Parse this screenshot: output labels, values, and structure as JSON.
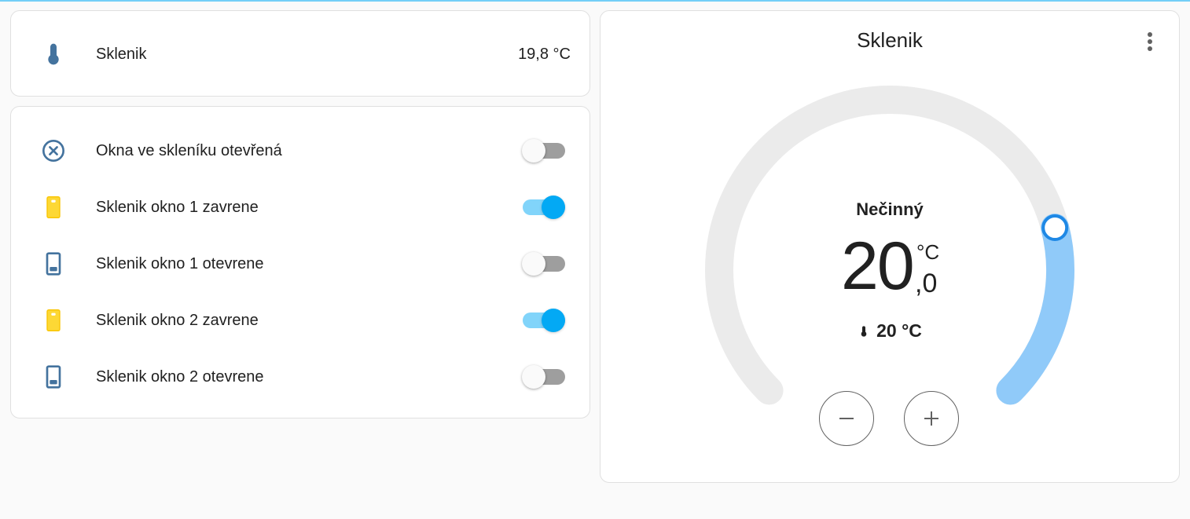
{
  "sensor": {
    "name": "Sklenik",
    "value": "19,8 °C"
  },
  "entities": [
    {
      "label": "Okna ve skleníku otevřená",
      "icon": "close-circle-outline-icon",
      "state": "off"
    },
    {
      "label": "Sklenik okno 1 zavrene",
      "icon": "window-closed-icon",
      "state": "on"
    },
    {
      "label": "Sklenik okno 1 otevrene",
      "icon": "window-open-icon",
      "state": "off"
    },
    {
      "label": "Sklenik okno 2 zavrene",
      "icon": "window-closed-icon",
      "state": "on"
    },
    {
      "label": "Sklenik okno 2 otevrene",
      "icon": "window-open-icon",
      "state": "off"
    }
  ],
  "thermostat": {
    "title": "Sklenik",
    "state": "Nečinný",
    "target_integer": "20",
    "target_decimal": ",0",
    "unit": "°C",
    "current": "20 °C",
    "minus": "−",
    "plus": "+",
    "setpoint_fraction": 0.78
  },
  "colors": {
    "accent": "#03a9f4",
    "accent_light": "#90caf9",
    "icon_blue": "#44739e",
    "icon_yellow": "#fdd835",
    "track_grey": "#ebebeb"
  }
}
